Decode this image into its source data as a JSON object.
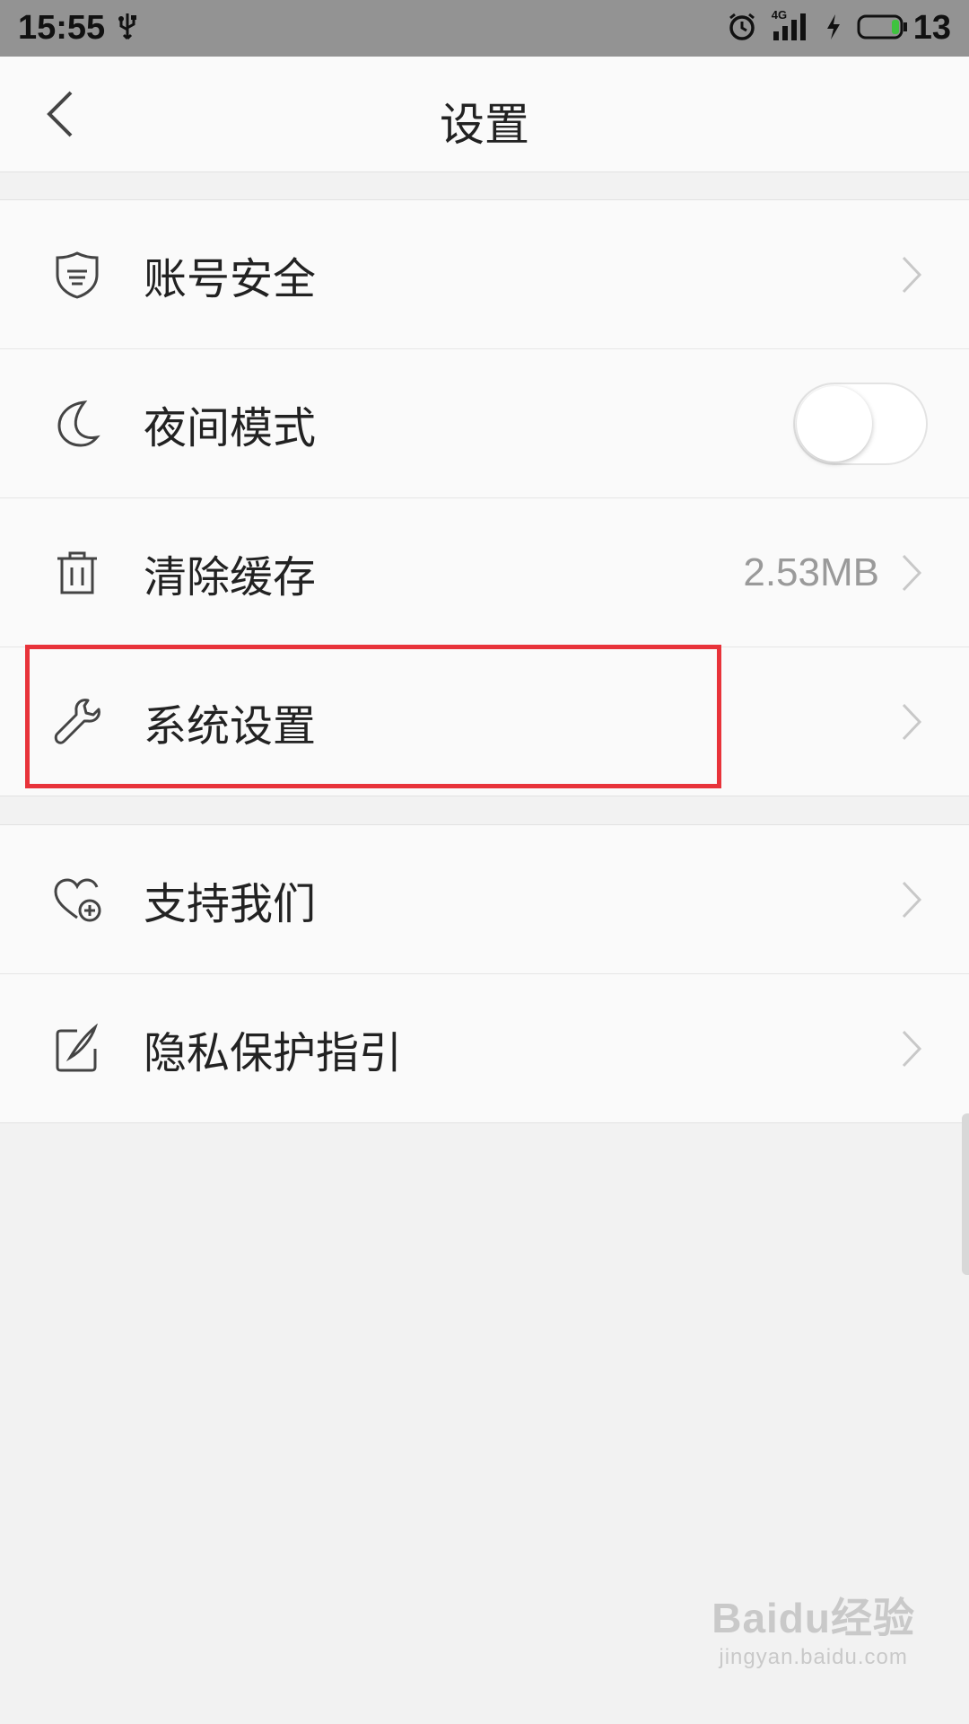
{
  "status_bar": {
    "time": "15:55",
    "network": "4G",
    "battery": "13",
    "icons": [
      "usb-icon",
      "alarm-icon",
      "signal-icon",
      "charging-icon",
      "battery-icon"
    ]
  },
  "header": {
    "title": "设置",
    "back_icon": "chevron-left-icon"
  },
  "groups": [
    {
      "items": [
        {
          "label": "账号安全",
          "icon": "shield-icon",
          "control": "chevron"
        },
        {
          "label": "夜间模式",
          "icon": "moon-icon",
          "control": "toggle",
          "toggle_on": false
        },
        {
          "label": "清除缓存",
          "icon": "trash-icon",
          "control": "chevron",
          "value": "2.53MB"
        },
        {
          "label": "系统设置",
          "icon": "wrench-icon",
          "control": "chevron",
          "highlighted": true
        }
      ]
    },
    {
      "items": [
        {
          "label": "支持我们",
          "icon": "heart-plus-icon",
          "control": "chevron"
        },
        {
          "label": "隐私保护指引",
          "icon": "edit-note-icon",
          "control": "chevron"
        }
      ]
    }
  ],
  "watermark": {
    "main": "Baidu经验",
    "sub": "jingyan.baidu.com"
  },
  "colors": {
    "status_bar_bg": "#939393",
    "page_bg": "#f2f2f2",
    "row_bg": "#fafafa",
    "highlight": "#e8333a",
    "value_text": "#9a9a9a"
  }
}
